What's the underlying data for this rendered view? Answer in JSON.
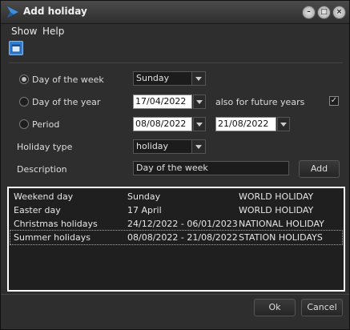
{
  "window": {
    "title": "Add holiday"
  },
  "menu": [
    {
      "label": "Show"
    },
    {
      "label": "Help"
    }
  ],
  "form": {
    "day_of_week": {
      "label": "Day of the week",
      "value": "Sunday",
      "checked": true
    },
    "day_of_year": {
      "label": "Day of the year",
      "date": "17/04/2022",
      "future_label": "also for future years",
      "future_checked": true
    },
    "period": {
      "label": "Period",
      "start": "08/08/2022",
      "end": "21/08/2022"
    },
    "holiday_type": {
      "label": "Holiday type",
      "value": "holiday"
    },
    "description": {
      "label": "Description",
      "value": "Day of the week"
    },
    "add_label": "Add"
  },
  "holidays": [
    {
      "name": "Weekend day",
      "date": "Sunday",
      "type": "WORLD HOLIDAY"
    },
    {
      "name": "Easter day",
      "date": "17 April",
      "type": "WORLD HOLIDAY"
    },
    {
      "name": "Christmas holidays",
      "date": "24/12/2022 - 06/01/2023",
      "type": "NATIONAL HOLIDAY"
    },
    {
      "name": "Summer holidays",
      "date": "08/08/2022 - 21/08/2022",
      "type": "STATION HOLIDAYS"
    }
  ],
  "buttons": {
    "ok": "Ok",
    "cancel": "Cancel"
  },
  "window_controls": {
    "minimize": "–",
    "maximize": "□",
    "close": "×",
    "check": "✓"
  }
}
